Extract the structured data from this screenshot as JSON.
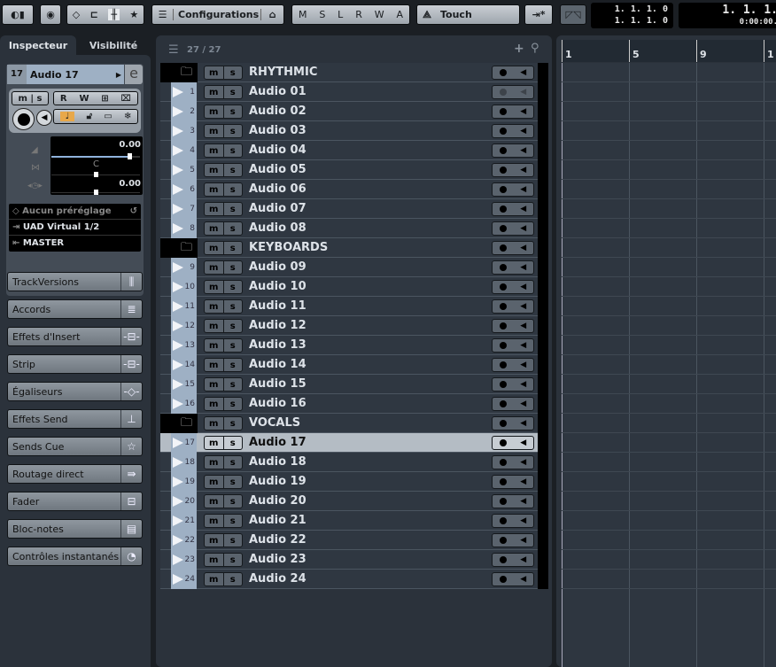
{
  "toolbar": {
    "configurations": "Configurations",
    "msl": [
      "M",
      "S",
      "L",
      "R",
      "W",
      "A"
    ],
    "automation_mode": "Touch",
    "lcd_left": [
      "1. 1. 1.   0",
      "1. 1. 1.   0"
    ],
    "lcd_right": [
      "1. 1. 1.",
      "0:00:00."
    ]
  },
  "inspector": {
    "tabs": [
      {
        "label": "Inspecteur",
        "active": true
      },
      {
        "label": "Visibilité",
        "active": false
      }
    ],
    "track_number": "17",
    "track_name": "Audio 17",
    "volume": "0.00",
    "pan_label": "C",
    "delay": "0.00",
    "volume_fraction": 0.88,
    "preset": "Aucun préréglage",
    "input": "UAD Virtual 1/2",
    "output": "MASTER",
    "accent": "#e8a84a",
    "sections": [
      {
        "label": "TrackVersions",
        "icon": "track-versions-icon",
        "glyph": "⫼"
      },
      {
        "label": "Accords",
        "icon": "chords-icon",
        "glyph": "≣"
      },
      {
        "label": "Effets d'Insert",
        "icon": "insert-icon",
        "glyph": "-⊟-"
      },
      {
        "label": "Strip",
        "icon": "strip-icon",
        "glyph": "-⊟-"
      },
      {
        "label": "Égaliseurs",
        "icon": "eq-icon",
        "glyph": "-◇-"
      },
      {
        "label": "Effets Send",
        "icon": "send-icon",
        "glyph": "⊥"
      },
      {
        "label": "Sends Cue",
        "icon": "star-icon",
        "glyph": "☆"
      },
      {
        "label": "Routage direct",
        "icon": "direct-routing-icon",
        "glyph": "⇛"
      },
      {
        "label": "Fader",
        "icon": "fader-icon",
        "glyph": "⊟"
      },
      {
        "label": "Bloc-notes",
        "icon": "notepad-icon",
        "glyph": "▤"
      },
      {
        "label": "Contrôles instantanés",
        "icon": "quick-controls-icon",
        "glyph": "◔"
      }
    ]
  },
  "tracklist": {
    "count": "27 / 27",
    "mute": "m",
    "solo": "s",
    "tracks": [
      {
        "type": "folder",
        "name": "RHYTHMIC"
      },
      {
        "type": "audio",
        "num": "1",
        "name": "Audio 01",
        "dim": true
      },
      {
        "type": "audio",
        "num": "2",
        "name": "Audio 02"
      },
      {
        "type": "audio",
        "num": "3",
        "name": "Audio 03"
      },
      {
        "type": "audio",
        "num": "4",
        "name": "Audio 04"
      },
      {
        "type": "audio",
        "num": "5",
        "name": "Audio 05"
      },
      {
        "type": "audio",
        "num": "6",
        "name": "Audio 06"
      },
      {
        "type": "audio",
        "num": "7",
        "name": "Audio 07"
      },
      {
        "type": "audio",
        "num": "8",
        "name": "Audio 08"
      },
      {
        "type": "folder",
        "name": "KEYBOARDS"
      },
      {
        "type": "audio",
        "num": "9",
        "name": "Audio 09"
      },
      {
        "type": "audio",
        "num": "10",
        "name": "Audio 10"
      },
      {
        "type": "audio",
        "num": "11",
        "name": "Audio 11"
      },
      {
        "type": "audio",
        "num": "12",
        "name": "Audio 12"
      },
      {
        "type": "audio",
        "num": "13",
        "name": "Audio 13"
      },
      {
        "type": "audio",
        "num": "14",
        "name": "Audio 14"
      },
      {
        "type": "audio",
        "num": "15",
        "name": "Audio 15"
      },
      {
        "type": "audio",
        "num": "16",
        "name": "Audio 16"
      },
      {
        "type": "folder",
        "name": "VOCALS"
      },
      {
        "type": "audio",
        "num": "17",
        "name": "Audio 17",
        "selected": true
      },
      {
        "type": "audio",
        "num": "18",
        "name": "Audio 18"
      },
      {
        "type": "audio",
        "num": "19",
        "name": "Audio 19"
      },
      {
        "type": "audio",
        "num": "20",
        "name": "Audio 20"
      },
      {
        "type": "audio",
        "num": "21",
        "name": "Audio 21"
      },
      {
        "type": "audio",
        "num": "22",
        "name": "Audio 22"
      },
      {
        "type": "audio",
        "num": "23",
        "name": "Audio 23"
      },
      {
        "type": "audio",
        "num": "24",
        "name": "Audio 24"
      }
    ]
  },
  "ruler": {
    "marks": [
      "1",
      "5",
      "9",
      "1"
    ]
  }
}
